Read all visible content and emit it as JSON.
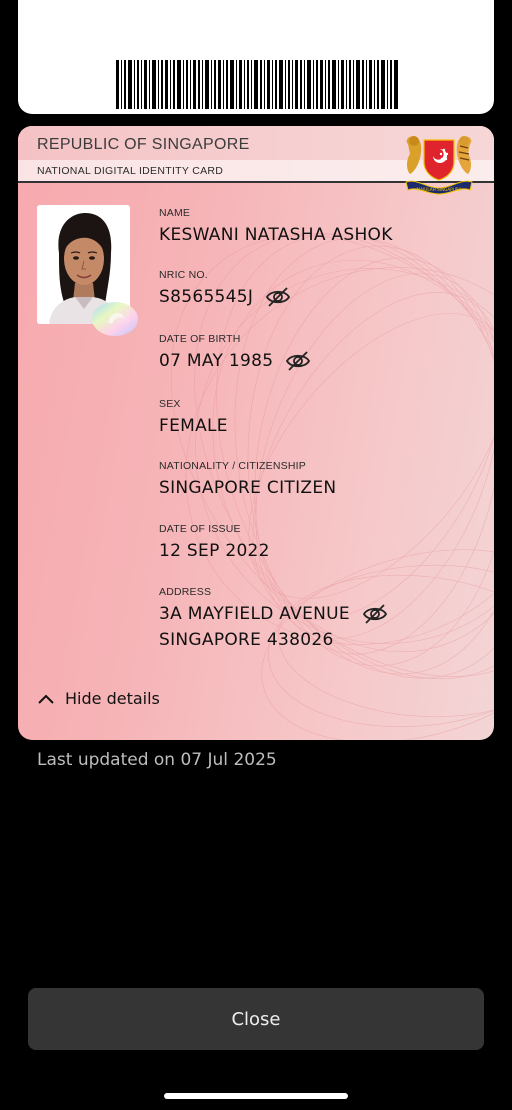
{
  "card": {
    "country": "REPUBLIC OF SINGAPORE",
    "subtitle": "NATIONAL DIGITAL IDENTITY CARD",
    "coat_of_arms_motto": "MAJULAH SINGAPURA"
  },
  "fields": [
    {
      "label": "NAME",
      "value": "KESWANI NATASHA ASHOK",
      "masked_toggle": false
    },
    {
      "label": "NRIC NO.",
      "value": "S8565545J",
      "masked_toggle": true
    },
    {
      "label": "DATE OF BIRTH",
      "value": "07 MAY 1985",
      "masked_toggle": true
    },
    {
      "label": "SEX",
      "value": "FEMALE",
      "masked_toggle": false
    },
    {
      "label": "NATIONALITY / CITIZENSHIP",
      "value": "SINGAPORE CITIZEN",
      "masked_toggle": false
    },
    {
      "label": "DATE OF ISSUE",
      "value": "12 SEP 2022",
      "masked_toggle": false
    },
    {
      "label": "ADDRESS",
      "value_line1": "3A MAYFIELD AVENUE",
      "value_line2": "SINGAPORE 438026",
      "masked_toggle": true
    }
  ],
  "hide_details_label": "Hide details",
  "last_updated": "Last updated on 07 Jul 2025",
  "close_label": "Close",
  "icons": {
    "eye": "eye-slash-icon",
    "chevron": "chevron-up-icon"
  },
  "colors": {
    "card_pink": "#f6b4b7",
    "background": "#000000",
    "button": "#353535",
    "flag_red": "#e0242e"
  }
}
